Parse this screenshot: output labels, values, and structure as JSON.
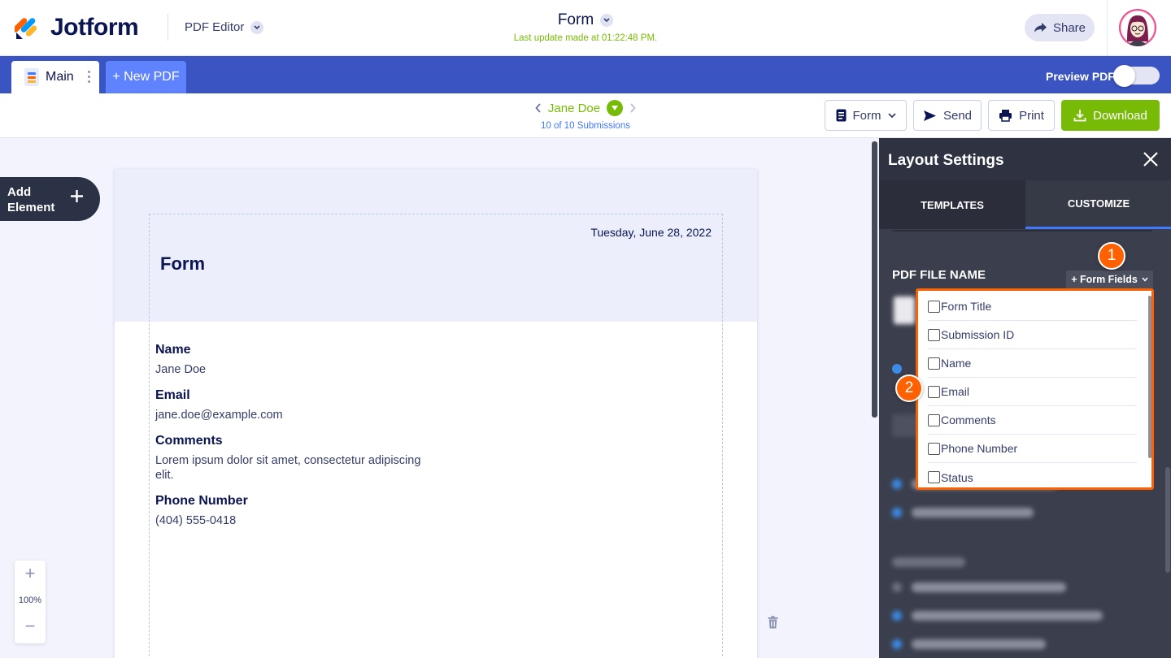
{
  "header": {
    "brand": "Jotform",
    "product": "PDF Editor",
    "doc_title": "Form",
    "last_update": "Last update made at 01:22:48 PM.",
    "share_label": "Share"
  },
  "tabs": {
    "main_label": "Main",
    "new_pdf_label": "+ New PDF",
    "preview_label": "Preview PDF",
    "preview_on": false
  },
  "toolbar": {
    "submitter": "Jane Doe",
    "submission_count": "10 of 10 Submissions",
    "form_label": "Form",
    "send_label": "Send",
    "print_label": "Print",
    "download_label": "Download"
  },
  "canvas": {
    "add_element_line1": "Add",
    "add_element_line2": "Element",
    "zoom": "100%",
    "date": "Tuesday, June 28, 2022",
    "title": "Form",
    "fields": [
      {
        "label": "Name",
        "value": "Jane Doe"
      },
      {
        "label": "Email",
        "value": "jane.doe@example.com"
      },
      {
        "label": "Comments",
        "value": "Lorem ipsum dolor sit amet, consectetur adipiscing elit."
      },
      {
        "label": "Phone Number",
        "value": "(404) 555-0418"
      }
    ]
  },
  "panel": {
    "title": "Layout Settings",
    "tab_templates": "TEMPLATES",
    "tab_customize": "CUSTOMIZE",
    "pdf_file_name": "PDF FILE NAME",
    "form_fields_btn": "+ Form Fields",
    "options": [
      "Form Title",
      "Submission ID",
      "Name",
      "Email",
      "Comments",
      "Phone Number",
      "Status"
    ]
  },
  "markers": {
    "one": "1",
    "two": "2"
  },
  "colors": {
    "brand_blue": "#3a54c1",
    "accent_green": "#78bb07",
    "highlight_orange": "#ff6100",
    "panel_dark": "#3b3f4d"
  }
}
